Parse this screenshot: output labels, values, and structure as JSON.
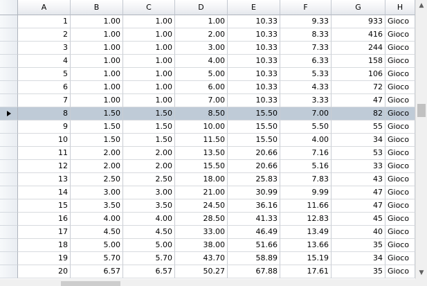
{
  "columns": [
    "A",
    "B",
    "C",
    "D",
    "E",
    "F",
    "G",
    "H"
  ],
  "selected_row_index": 7,
  "rows": [
    [
      "1",
      "1.00",
      "1.00",
      "1.00",
      "10.33",
      "9.33",
      "933",
      "Gioco"
    ],
    [
      "2",
      "1.00",
      "1.00",
      "2.00",
      "10.33",
      "8.33",
      "416",
      "Gioco"
    ],
    [
      "3",
      "1.00",
      "1.00",
      "3.00",
      "10.33",
      "7.33",
      "244",
      "Gioco"
    ],
    [
      "4",
      "1.00",
      "1.00",
      "4.00",
      "10.33",
      "6.33",
      "158",
      "Gioco"
    ],
    [
      "5",
      "1.00",
      "1.00",
      "5.00",
      "10.33",
      "5.33",
      "106",
      "Gioco"
    ],
    [
      "6",
      "1.00",
      "1.00",
      "6.00",
      "10.33",
      "4.33",
      "72",
      "Gioco"
    ],
    [
      "7",
      "1.00",
      "1.00",
      "7.00",
      "10.33",
      "3.33",
      "47",
      "Gioco"
    ],
    [
      "8",
      "1.50",
      "1.50",
      "8.50",
      "15.50",
      "7.00",
      "82",
      "Gioco"
    ],
    [
      "9",
      "1.50",
      "1.50",
      "10.00",
      "15.50",
      "5.50",
      "55",
      "Gioco"
    ],
    [
      "10",
      "1.50",
      "1.50",
      "11.50",
      "15.50",
      "4.00",
      "34",
      "Gioco"
    ],
    [
      "11",
      "2.00",
      "2.00",
      "13.50",
      "20.66",
      "7.16",
      "53",
      "Gioco"
    ],
    [
      "12",
      "2.00",
      "2.00",
      "15.50",
      "20.66",
      "5.16",
      "33",
      "Gioco"
    ],
    [
      "13",
      "2.50",
      "2.50",
      "18.00",
      "25.83",
      "7.83",
      "43",
      "Gioco"
    ],
    [
      "14",
      "3.00",
      "3.00",
      "21.00",
      "30.99",
      "9.99",
      "47",
      "Gioco"
    ],
    [
      "15",
      "3.50",
      "3.50",
      "24.50",
      "36.16",
      "11.66",
      "47",
      "Gioco"
    ],
    [
      "16",
      "4.00",
      "4.00",
      "28.50",
      "41.33",
      "12.83",
      "45",
      "Gioco"
    ],
    [
      "17",
      "4.50",
      "4.50",
      "33.00",
      "46.49",
      "13.49",
      "40",
      "Gioco"
    ],
    [
      "18",
      "5.00",
      "5.00",
      "38.00",
      "51.66",
      "13.66",
      "35",
      "Gioco"
    ],
    [
      "19",
      "5.70",
      "5.70",
      "43.70",
      "58.89",
      "15.19",
      "34",
      "Gioco"
    ],
    [
      "20",
      "6.57",
      "6.57",
      "50.27",
      "67.88",
      "17.61",
      "35",
      "Gioco"
    ]
  ],
  "icons": {
    "row_indicator": "current-row-arrow-icon",
    "scroll_up": "chevron-up-icon",
    "scroll_down": "chevron-down-icon"
  }
}
